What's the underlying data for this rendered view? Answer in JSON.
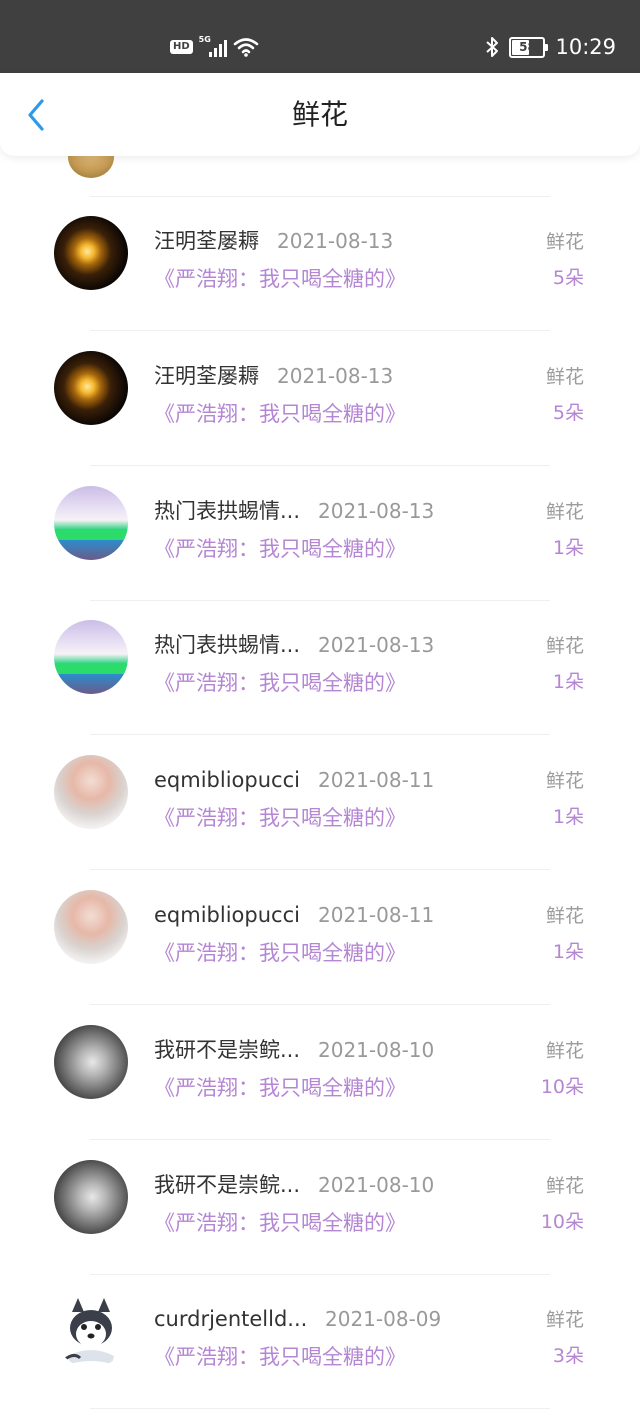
{
  "status_bar": {
    "hd": "HD",
    "network": "5G",
    "battery": "58",
    "battery_level": 0.58,
    "time": "10:29"
  },
  "header": {
    "title": "鲜花",
    "back_icon": "chevron-left-icon",
    "accent_color": "#2b9ae8"
  },
  "colors": {
    "purple_text": "#b486d4",
    "gray_text": "#999999",
    "status_bar_bg": "#404040"
  },
  "records": [
    {
      "name": "汪明荃屡耨",
      "date": "2021-08-13",
      "subtitle": "《严浩翔：我只喝全糖的》",
      "gift_label": "鲜花",
      "gift_count": "5朵",
      "avatar": "lamp-avatar"
    },
    {
      "name": "汪明荃屡耨",
      "date": "2021-08-13",
      "subtitle": "《严浩翔：我只喝全糖的》",
      "gift_label": "鲜花",
      "gift_count": "5朵",
      "avatar": "lamp-avatar"
    },
    {
      "name": "热门表拱蜴情...",
      "date": "2021-08-13",
      "subtitle": "《严浩翔：我只喝全糖的》",
      "gift_label": "鲜花",
      "gift_count": "1朵",
      "avatar": "girl-avatar"
    },
    {
      "name": "热门表拱蜴情...",
      "date": "2021-08-13",
      "subtitle": "《严浩翔：我只喝全糖的》",
      "gift_label": "鲜花",
      "gift_count": "1朵",
      "avatar": "girl-avatar"
    },
    {
      "name": "eqmibliopucci",
      "date": "2021-08-11",
      "subtitle": "《严浩翔：我只喝全糖的》",
      "gift_label": "鲜花",
      "gift_count": "1朵",
      "avatar": "kid-avatar"
    },
    {
      "name": "eqmibliopucci",
      "date": "2021-08-11",
      "subtitle": "《严浩翔：我只喝全糖的》",
      "gift_label": "鲜花",
      "gift_count": "1朵",
      "avatar": "kid-avatar"
    },
    {
      "name": "我研不是崇鲩...",
      "date": "2021-08-10",
      "subtitle": "《严浩翔：我只喝全糖的》",
      "gift_label": "鲜花",
      "gift_count": "10朵",
      "avatar": "bw-child-avatar"
    },
    {
      "name": "我研不是崇鲩...",
      "date": "2021-08-10",
      "subtitle": "《严浩翔：我只喝全糖的》",
      "gift_label": "鲜花",
      "gift_count": "10朵",
      "avatar": "bw-child-avatar"
    },
    {
      "name": "curdrjentelld...",
      "date": "2021-08-09",
      "subtitle": "《严浩翔：我只喝全糖的》",
      "gift_label": "鲜花",
      "gift_count": "3朵",
      "avatar": "husky-avatar"
    }
  ]
}
